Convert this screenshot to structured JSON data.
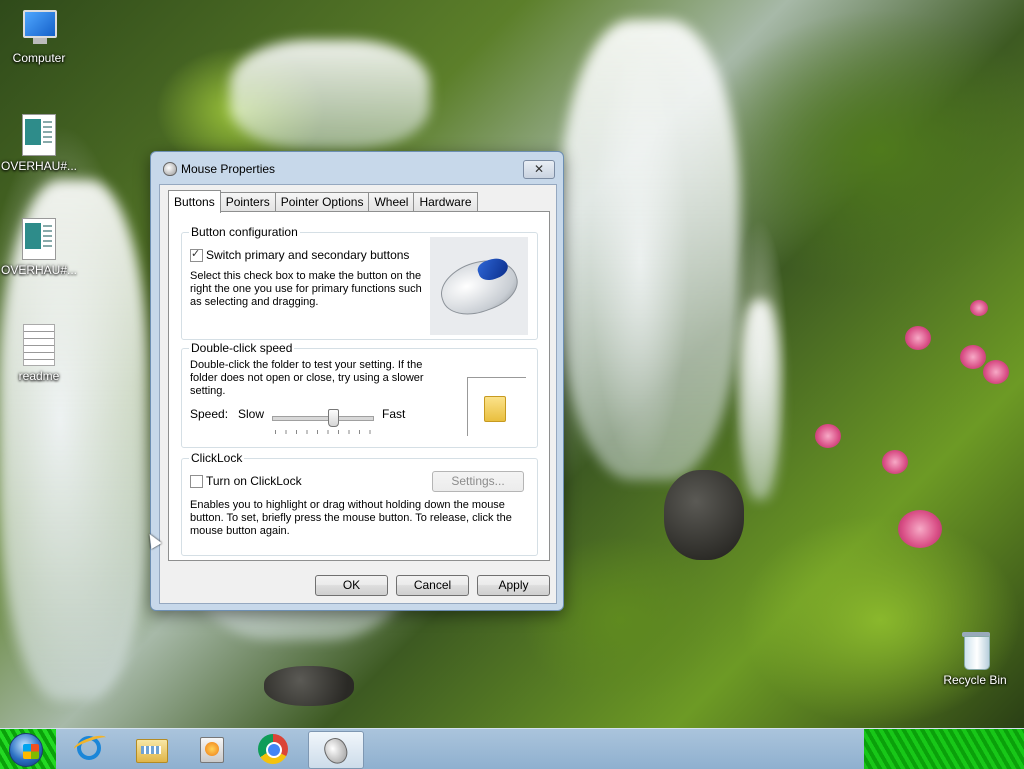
{
  "desktop": {
    "icons": [
      {
        "label": "Computer",
        "icon": "computer-icon"
      },
      {
        "label": "OVERHAU#...",
        "icon": "document-icon"
      },
      {
        "label": "OVERHAU#...",
        "icon": "document-icon"
      },
      {
        "label": "readme",
        "icon": "text-file-icon"
      },
      {
        "label": "Recycle Bin",
        "icon": "recycle-bin-icon"
      }
    ]
  },
  "dialog": {
    "title": "Mouse Properties",
    "close_label": "✕",
    "tabs": [
      "Buttons",
      "Pointers",
      "Pointer Options",
      "Wheel",
      "Hardware"
    ],
    "active_tab": "Buttons",
    "button_config": {
      "title": "Button configuration",
      "checkbox_label": "Switch primary and secondary buttons",
      "checked": true,
      "description": "Select this check box to make the button on the right the one you use for primary functions such as selecting and dragging."
    },
    "double_click": {
      "title": "Double-click speed",
      "description": "Double-click the folder to test your setting. If the folder does not open or close, try using a slower setting.",
      "speed_label": "Speed:",
      "slow_label": "Slow",
      "fast_label": "Fast",
      "slider_value": 0.6
    },
    "clicklock": {
      "title": "ClickLock",
      "checkbox_label": "Turn on ClickLock",
      "checked": false,
      "settings_button": "Settings...",
      "description": "Enables you to highlight or drag without holding down the mouse button. To set, briefly press the mouse button. To release, click the mouse button again."
    },
    "buttons": {
      "ok": "OK",
      "cancel": "Cancel",
      "apply": "Apply"
    }
  },
  "taskbar": {
    "items": [
      "start-orb-icon",
      "internet-explorer-icon",
      "file-explorer-icon",
      "media-player-icon",
      "chrome-icon",
      "mouse-properties-icon"
    ],
    "active_item": "mouse-properties-icon"
  }
}
